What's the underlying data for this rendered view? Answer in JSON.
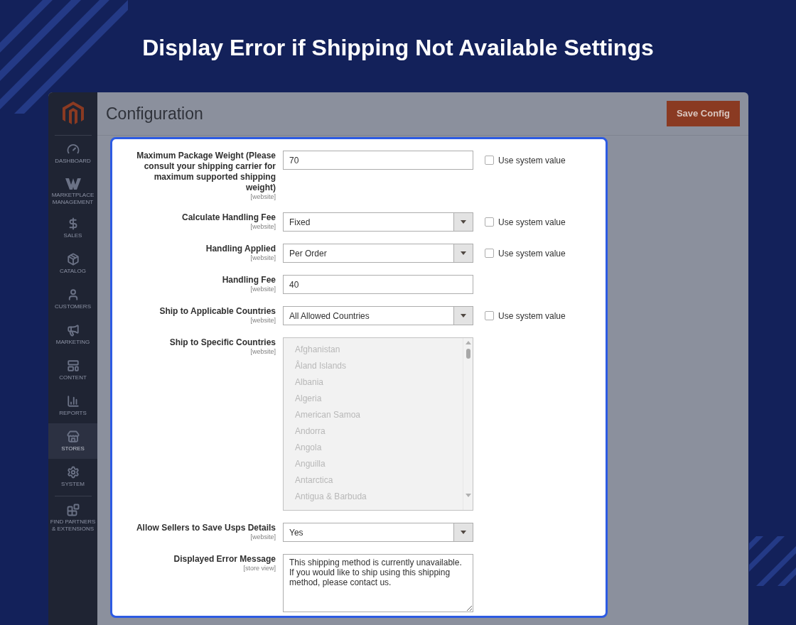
{
  "banner": {
    "title": "Display Error if Shipping Not Available Settings"
  },
  "sidebar": {
    "items": [
      {
        "label": "DASHBOARD",
        "selected": false
      },
      {
        "label": "MARKETPLACE MANAGEMENT",
        "selected": false
      },
      {
        "label": "SALES",
        "selected": false
      },
      {
        "label": "CATALOG",
        "selected": false
      },
      {
        "label": "CUSTOMERS",
        "selected": false
      },
      {
        "label": "MARKETING",
        "selected": false
      },
      {
        "label": "CONTENT",
        "selected": false
      },
      {
        "label": "REPORTS",
        "selected": false
      },
      {
        "label": "STORES",
        "selected": true
      },
      {
        "label": "SYSTEM",
        "selected": false
      },
      {
        "label": "FIND PARTNERS & EXTENSIONS",
        "selected": false
      }
    ]
  },
  "header": {
    "title": "Configuration",
    "save_button": "Save Config"
  },
  "form": {
    "fields": [
      {
        "kind": "text",
        "label": "Maximum Package Weight (Please consult your shipping carrier for maximum supported shipping weight)",
        "scope": "[website]",
        "value": "70",
        "use_system_value": {
          "label": "Use system value",
          "checked": false
        }
      },
      {
        "kind": "select",
        "label": "Calculate Handling Fee",
        "scope": "[website]",
        "value": "Fixed",
        "use_system_value": {
          "label": "Use system value",
          "checked": false
        }
      },
      {
        "kind": "select",
        "label": "Handling Applied",
        "scope": "[website]",
        "value": "Per Order",
        "use_system_value": {
          "label": "Use system value",
          "checked": false
        }
      },
      {
        "kind": "text",
        "label": "Handling Fee",
        "scope": "[website]",
        "value": "40"
      },
      {
        "kind": "select",
        "label": "Ship to Applicable Countries",
        "scope": "[website]",
        "value": "All Allowed Countries",
        "use_system_value": {
          "label": "Use system value",
          "checked": false
        }
      },
      {
        "kind": "multiselect",
        "label": "Ship to Specific Countries",
        "scope": "[website]",
        "disabled": true,
        "options": [
          "Afghanistan",
          "Åland Islands",
          "Albania",
          "Algeria",
          "American Samoa",
          "Andorra",
          "Angola",
          "Anguilla",
          "Antarctica",
          "Antigua & Barbuda"
        ]
      },
      {
        "kind": "select",
        "label": "Allow Sellers to Save Usps Details",
        "scope": "[website]",
        "value": "Yes"
      },
      {
        "kind": "textarea",
        "label": "Displayed Error Message",
        "scope": "[store view]",
        "value": "This shipping method is currently unavailable. If you would like to ship using this shipping method, please contact us."
      }
    ]
  }
}
